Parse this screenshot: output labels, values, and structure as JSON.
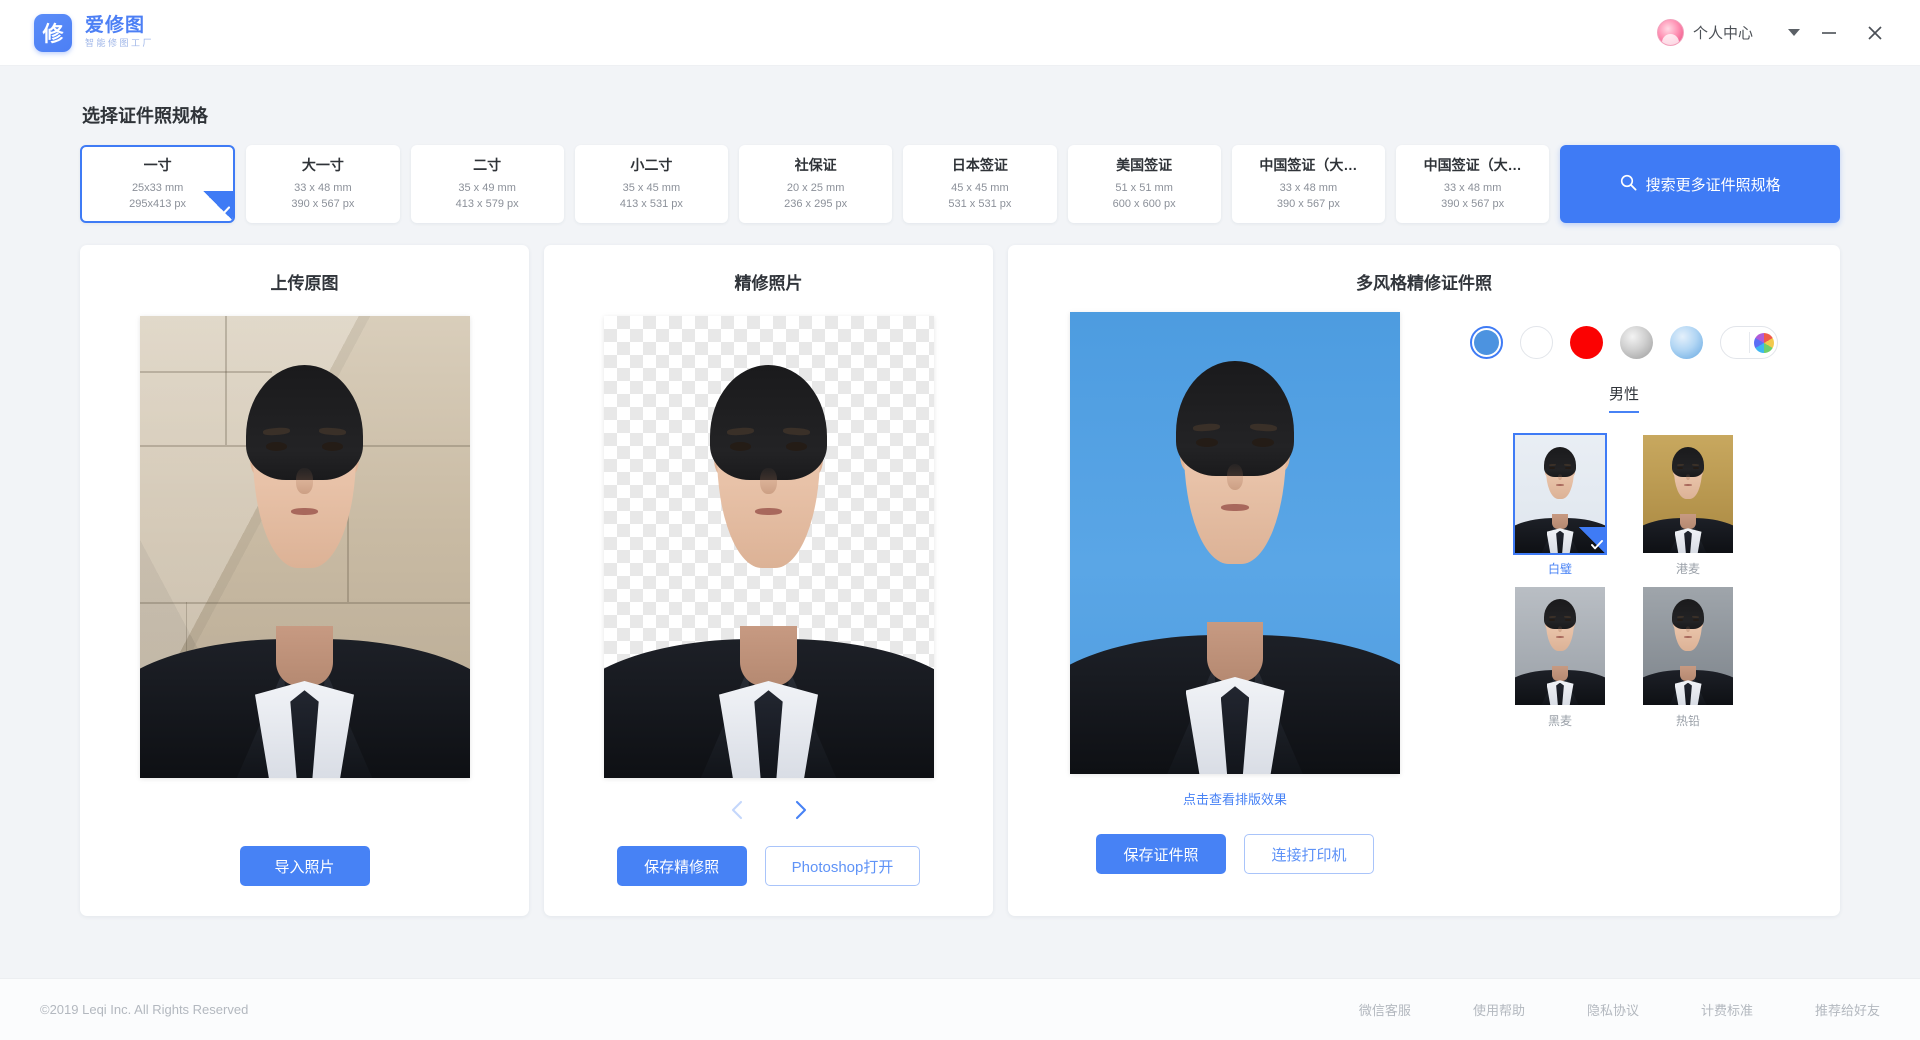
{
  "titlebar": {
    "brand_name": "爱修图",
    "brand_sub": "智能修图工厂",
    "logo_glyph": "修",
    "user_name": "个人中心",
    "minimize_label": "—",
    "close_label": "✕"
  },
  "specs": {
    "section_title": "选择证件照规格",
    "items": [
      {
        "name": "一寸",
        "mm": "25x33 mm",
        "px": "295x413 px",
        "selected": true
      },
      {
        "name": "大一寸",
        "mm": "33 x 48 mm",
        "px": "390 x 567 px",
        "selected": false
      },
      {
        "name": "二寸",
        "mm": "35 x 49 mm",
        "px": "413 x 579 px",
        "selected": false
      },
      {
        "name": "小二寸",
        "mm": "35 x 45 mm",
        "px": "413 x 531 px",
        "selected": false
      },
      {
        "name": "社保证",
        "mm": "20 x 25 mm",
        "px": "236 x 295 px",
        "selected": false
      },
      {
        "name": "日本签证",
        "mm": "45 x 45 mm",
        "px": "531 x 531 px",
        "selected": false
      },
      {
        "name": "美国签证",
        "mm": "51 x 51 mm",
        "px": "600 x 600 px",
        "selected": false
      },
      {
        "name": "中国签证（大…",
        "mm": "33 x 48 mm",
        "px": "390 x 567 px",
        "selected": false
      },
      {
        "name": "中国签证（大…",
        "mm": "33 x 48 mm",
        "px": "390 x 567 px",
        "selected": false
      }
    ],
    "search_label": "搜索更多证件照规格",
    "search_icon": "search-icon"
  },
  "panel_upload": {
    "title": "上传原图",
    "import_label": "导入照片"
  },
  "panel_retouch": {
    "title": "精修照片",
    "prev_icon": "chevron-left-icon",
    "next_icon": "chevron-right-icon",
    "save_label": "保存精修照",
    "photoshop_label": "Photoshop打开"
  },
  "panel_styles": {
    "title": "多风格精修证件照",
    "layout_link": "点击查看排版效果",
    "save_label": "保存证件照",
    "print_label": "连接打印机",
    "colors": [
      {
        "name": "blue",
        "hex": "#4c93e0",
        "selected": true
      },
      {
        "name": "white",
        "hex": "#ffffff",
        "selected": false
      },
      {
        "name": "red",
        "hex": "#fb0202",
        "selected": false
      },
      {
        "name": "gray-gradient",
        "hex": "#cfcfcf",
        "selected": false
      },
      {
        "name": "blue-gradient",
        "hex": "#b2d6f4",
        "selected": false
      },
      {
        "name": "custom",
        "hex": "#ffffff",
        "selected": false
      }
    ],
    "gender_tabs": [
      {
        "label": "男性",
        "active": true
      }
    ],
    "styles": [
      {
        "label": "白璧",
        "selected": true
      },
      {
        "label": "港麦",
        "selected": false
      },
      {
        "label": "黑麦",
        "selected": false
      },
      {
        "label": "热铅",
        "selected": false
      }
    ]
  },
  "footer": {
    "copyright": "©2019 Leqi Inc. All Rights Reserved",
    "links": [
      "微信客服",
      "使用帮助",
      "隐私协议",
      "计费标准",
      "推荐给好友"
    ]
  },
  "theme": {
    "accent": "#4782f5",
    "accent_strong": "#3f7bf5",
    "bg": "#f2f4f7"
  }
}
